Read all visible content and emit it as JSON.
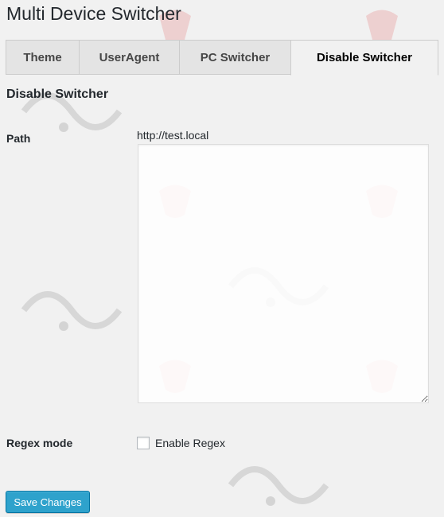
{
  "page": {
    "title": "Multi Device Switcher"
  },
  "tabs": [
    {
      "label": "Theme",
      "active": false
    },
    {
      "label": "UserAgent",
      "active": false
    },
    {
      "label": "PC Switcher",
      "active": false
    },
    {
      "label": "Disable Switcher",
      "active": true
    }
  ],
  "section": {
    "title": "Disable Switcher"
  },
  "path": {
    "label": "Path",
    "host": "http://test.local",
    "value": ""
  },
  "regex": {
    "label": "Regex mode",
    "checkbox_label": "Enable Regex",
    "checked": false
  },
  "actions": {
    "save_label": "Save Changes"
  },
  "colors": {
    "accent": "#2ea2cc",
    "background": "#f1f1f1",
    "watermark": "#e04040"
  }
}
